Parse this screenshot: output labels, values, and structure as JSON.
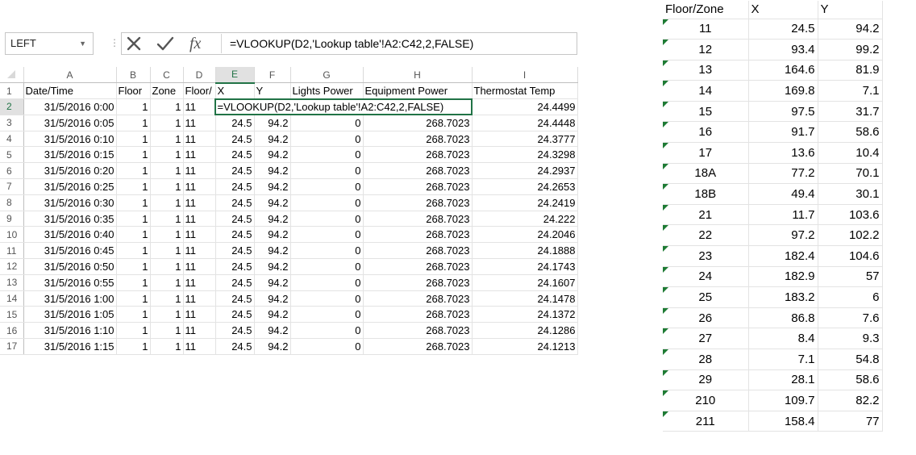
{
  "name_box": {
    "value": "LEFT"
  },
  "formula_bar": {
    "cancel_icon": "x-icon",
    "enter_icon": "check-icon",
    "function_icon": "fx-icon",
    "formula": "=VLOOKUP(D2,'Lookup table'!A2:C42,2,FALSE)"
  },
  "sheet": {
    "selected_column": "E",
    "selected_row": "2",
    "col_headers": [
      "A",
      "B",
      "C",
      "D",
      "E",
      "F",
      "G",
      "H",
      "I"
    ],
    "header_row": [
      "Date/Time",
      "Floor",
      "Zone",
      "Floor/",
      "X",
      "Y",
      "Lights Power",
      "Equipment Power",
      "Thermostat Temp"
    ],
    "editing_cell_text": "=VLOOKUP(D2,'Lookup table'!A2:C42,2,FALSE)",
    "row2_temp": "24.4499",
    "rows": [
      {
        "n": "3",
        "dt": "31/5/2016 0:05",
        "fl": "1",
        "zn": "1",
        "fz": "11",
        "x": "24.5",
        "y": "94.2",
        "lp": "0",
        "ep": "268.7023",
        "tt": "24.4448"
      },
      {
        "n": "4",
        "dt": "31/5/2016 0:10",
        "fl": "1",
        "zn": "1",
        "fz": "11",
        "x": "24.5",
        "y": "94.2",
        "lp": "0",
        "ep": "268.7023",
        "tt": "24.3777"
      },
      {
        "n": "5",
        "dt": "31/5/2016 0:15",
        "fl": "1",
        "zn": "1",
        "fz": "11",
        "x": "24.5",
        "y": "94.2",
        "lp": "0",
        "ep": "268.7023",
        "tt": "24.3298"
      },
      {
        "n": "6",
        "dt": "31/5/2016 0:20",
        "fl": "1",
        "zn": "1",
        "fz": "11",
        "x": "24.5",
        "y": "94.2",
        "lp": "0",
        "ep": "268.7023",
        "tt": "24.2937"
      },
      {
        "n": "7",
        "dt": "31/5/2016 0:25",
        "fl": "1",
        "zn": "1",
        "fz": "11",
        "x": "24.5",
        "y": "94.2",
        "lp": "0",
        "ep": "268.7023",
        "tt": "24.2653"
      },
      {
        "n": "8",
        "dt": "31/5/2016 0:30",
        "fl": "1",
        "zn": "1",
        "fz": "11",
        "x": "24.5",
        "y": "94.2",
        "lp": "0",
        "ep": "268.7023",
        "tt": "24.2419"
      },
      {
        "n": "9",
        "dt": "31/5/2016 0:35",
        "fl": "1",
        "zn": "1",
        "fz": "11",
        "x": "24.5",
        "y": "94.2",
        "lp": "0",
        "ep": "268.7023",
        "tt": "24.222"
      },
      {
        "n": "10",
        "dt": "31/5/2016 0:40",
        "fl": "1",
        "zn": "1",
        "fz": "11",
        "x": "24.5",
        "y": "94.2",
        "lp": "0",
        "ep": "268.7023",
        "tt": "24.2046"
      },
      {
        "n": "11",
        "dt": "31/5/2016 0:45",
        "fl": "1",
        "zn": "1",
        "fz": "11",
        "x": "24.5",
        "y": "94.2",
        "lp": "0",
        "ep": "268.7023",
        "tt": "24.1888"
      },
      {
        "n": "12",
        "dt": "31/5/2016 0:50",
        "fl": "1",
        "zn": "1",
        "fz": "11",
        "x": "24.5",
        "y": "94.2",
        "lp": "0",
        "ep": "268.7023",
        "tt": "24.1743"
      },
      {
        "n": "13",
        "dt": "31/5/2016 0:55",
        "fl": "1",
        "zn": "1",
        "fz": "11",
        "x": "24.5",
        "y": "94.2",
        "lp": "0",
        "ep": "268.7023",
        "tt": "24.1607"
      },
      {
        "n": "14",
        "dt": "31/5/2016 1:00",
        "fl": "1",
        "zn": "1",
        "fz": "11",
        "x": "24.5",
        "y": "94.2",
        "lp": "0",
        "ep": "268.7023",
        "tt": "24.1478"
      },
      {
        "n": "15",
        "dt": "31/5/2016 1:05",
        "fl": "1",
        "zn": "1",
        "fz": "11",
        "x": "24.5",
        "y": "94.2",
        "lp": "0",
        "ep": "268.7023",
        "tt": "24.1372"
      },
      {
        "n": "16",
        "dt": "31/5/2016 1:10",
        "fl": "1",
        "zn": "1",
        "fz": "11",
        "x": "24.5",
        "y": "94.2",
        "lp": "0",
        "ep": "268.7023",
        "tt": "24.1286"
      },
      {
        "n": "17",
        "dt": "31/5/2016 1:15",
        "fl": "1",
        "zn": "1",
        "fz": "11",
        "x": "24.5",
        "y": "94.2",
        "lp": "0",
        "ep": "268.7023",
        "tt": "24.1213"
      }
    ],
    "row2": {
      "n": "2",
      "dt": "31/5/2016 0:00",
      "fl": "1",
      "zn": "1",
      "fz": "11"
    }
  },
  "lookup_table": {
    "headers": [
      "Floor/Zone",
      "X",
      "Y"
    ],
    "rows": [
      [
        "11",
        "24.5",
        "94.2"
      ],
      [
        "12",
        "93.4",
        "99.2"
      ],
      [
        "13",
        "164.6",
        "81.9"
      ],
      [
        "14",
        "169.8",
        "7.1"
      ],
      [
        "15",
        "97.5",
        "31.7"
      ],
      [
        "16",
        "91.7",
        "58.6"
      ],
      [
        "17",
        "13.6",
        "10.4"
      ],
      [
        "18A",
        "77.2",
        "70.1"
      ],
      [
        "18B",
        "49.4",
        "30.1"
      ],
      [
        "21",
        "11.7",
        "103.6"
      ],
      [
        "22",
        "97.2",
        "102.2"
      ],
      [
        "23",
        "182.4",
        "104.6"
      ],
      [
        "24",
        "182.9",
        "57"
      ],
      [
        "25",
        "183.2",
        "6"
      ],
      [
        "26",
        "86.8",
        "7.6"
      ],
      [
        "27",
        "8.4",
        "9.3"
      ],
      [
        "28",
        "7.1",
        "54.8"
      ],
      [
        "29",
        "28.1",
        "58.6"
      ],
      [
        "210",
        "109.7",
        "82.2"
      ],
      [
        "211",
        "158.4",
        "77"
      ]
    ]
  },
  "colors": {
    "excel_green": "#217346",
    "error_triangle": "#1e7b34",
    "gridline": "#e3e3e3"
  }
}
